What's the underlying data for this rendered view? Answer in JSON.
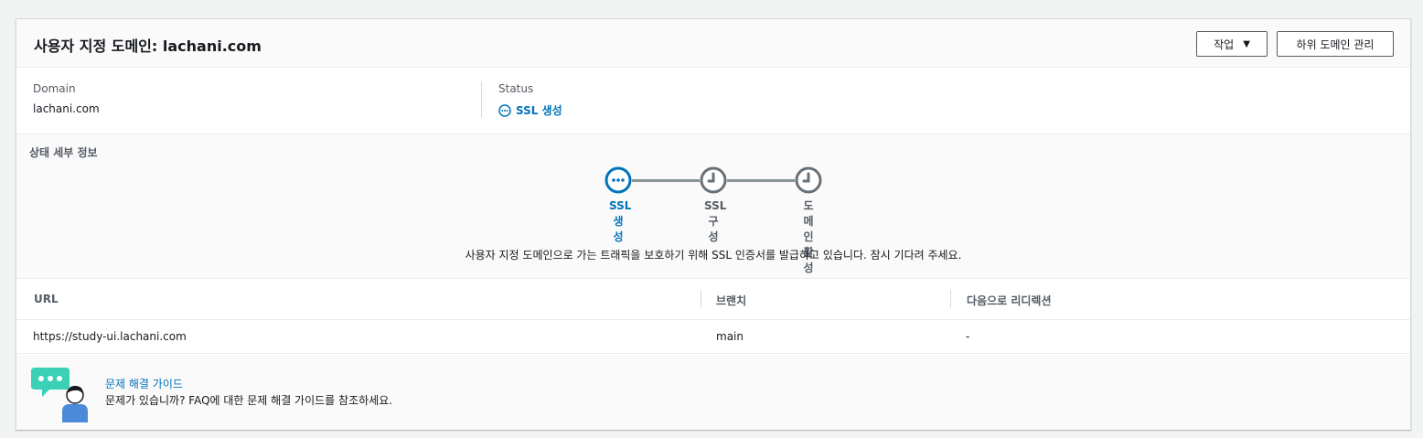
{
  "header": {
    "title": "사용자 지정 도메인: lachani.com",
    "actions_label": "작업",
    "subdomain_label": "하위 도메인 관리"
  },
  "summary": {
    "domain_label": "Domain",
    "domain_value": "lachani.com",
    "status_label": "Status",
    "status_value": "SSL 생성"
  },
  "status_details": {
    "heading": "상태 세부 정보",
    "steps": [
      {
        "chars": [
          "SSL",
          "생",
          "성"
        ],
        "state": "active"
      },
      {
        "chars": [
          "SSL",
          "구",
          "성"
        ],
        "state": "pending"
      },
      {
        "chars": [
          "도",
          "메",
          "인",
          "활",
          "성"
        ],
        "state": "pending"
      }
    ],
    "message": "사용자 지정 도메인으로 가는 트래픽을 보호하기 위해 SSL 인증서를 발급하고 있습니다. 잠시 기다려 주세요."
  },
  "table": {
    "headers": [
      "URL",
      "브랜치",
      "다음으로 리디렉션"
    ],
    "rows": [
      [
        "https://study-ui.lachani.com",
        "main",
        "-"
      ]
    ]
  },
  "help": {
    "link": "문제 해결 가이드",
    "description": "문제가 있습니까? FAQ에 대한 문제 해결 가이드를 참조하세요."
  },
  "colors": {
    "accent": "#0073bb",
    "pending": "#687078",
    "chat_bubble": "#3ad1b6",
    "avatar_shirt": "#4b8ad8"
  }
}
